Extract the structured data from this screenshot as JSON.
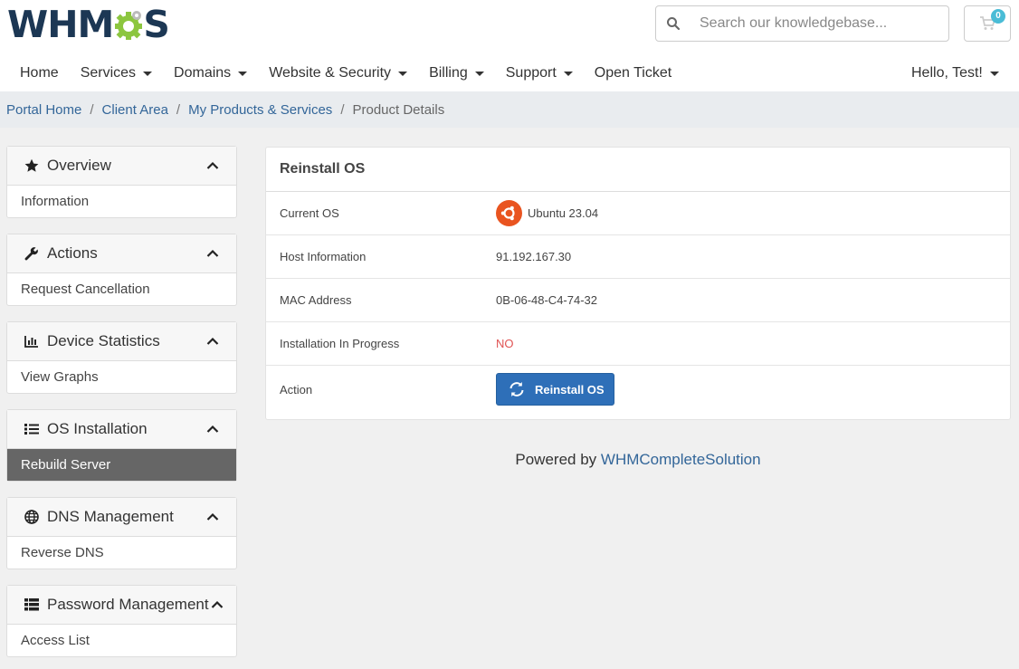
{
  "brand": {
    "logo_prefix": "WHM",
    "logo_suffix": "S"
  },
  "search": {
    "placeholder": "Search our knowledgebase..."
  },
  "cart": {
    "count": "0"
  },
  "nav": {
    "items": [
      {
        "label": "Home",
        "dropdown": false
      },
      {
        "label": "Services",
        "dropdown": true
      },
      {
        "label": "Domains",
        "dropdown": true
      },
      {
        "label": "Website & Security",
        "dropdown": true
      },
      {
        "label": "Billing",
        "dropdown": true
      },
      {
        "label": "Support",
        "dropdown": true
      },
      {
        "label": "Open Ticket",
        "dropdown": false
      }
    ],
    "user": "Hello, Test!"
  },
  "breadcrumb": {
    "items": [
      "Portal Home",
      "Client Area",
      "My Products & Services"
    ],
    "current": "Product Details"
  },
  "sidebar": {
    "panels": [
      {
        "title": "Overview",
        "icon": "star-icon",
        "items": [
          "Information"
        ]
      },
      {
        "title": "Actions",
        "icon": "wrench-icon",
        "items": [
          "Request Cancellation"
        ]
      },
      {
        "title": "Device Statistics",
        "icon": "bar-chart-icon",
        "items": [
          "View Graphs"
        ]
      },
      {
        "title": "OS Installation",
        "icon": "list-icon",
        "items": [
          "Rebuild Server"
        ]
      },
      {
        "title": "DNS Management",
        "icon": "globe-icon",
        "items": [
          "Reverse DNS"
        ]
      },
      {
        "title": "Password Management",
        "icon": "table-icon",
        "items": [
          "Access List"
        ]
      }
    ]
  },
  "main": {
    "title": "Reinstall OS",
    "rows": [
      {
        "label": "Current OS",
        "value": "Ubuntu 23.04"
      },
      {
        "label": "Host Information",
        "value": "91.192.167.30"
      },
      {
        "label": "MAC Address",
        "value": "0B-06-48-C4-74-32"
      },
      {
        "label": "Installation In Progress",
        "value": "NO"
      },
      {
        "label": "Action",
        "value": "Reinstall OS"
      }
    ]
  },
  "footer": {
    "text": "Powered by",
    "link": "WHMCompleteSolution"
  },
  "colors": {
    "brand": "#1c3754",
    "accent": "#2e6fb8",
    "gear": "#8cc63f",
    "ubuntu": "#e95420",
    "status_no": "#e05353",
    "active_item": "#666666"
  }
}
